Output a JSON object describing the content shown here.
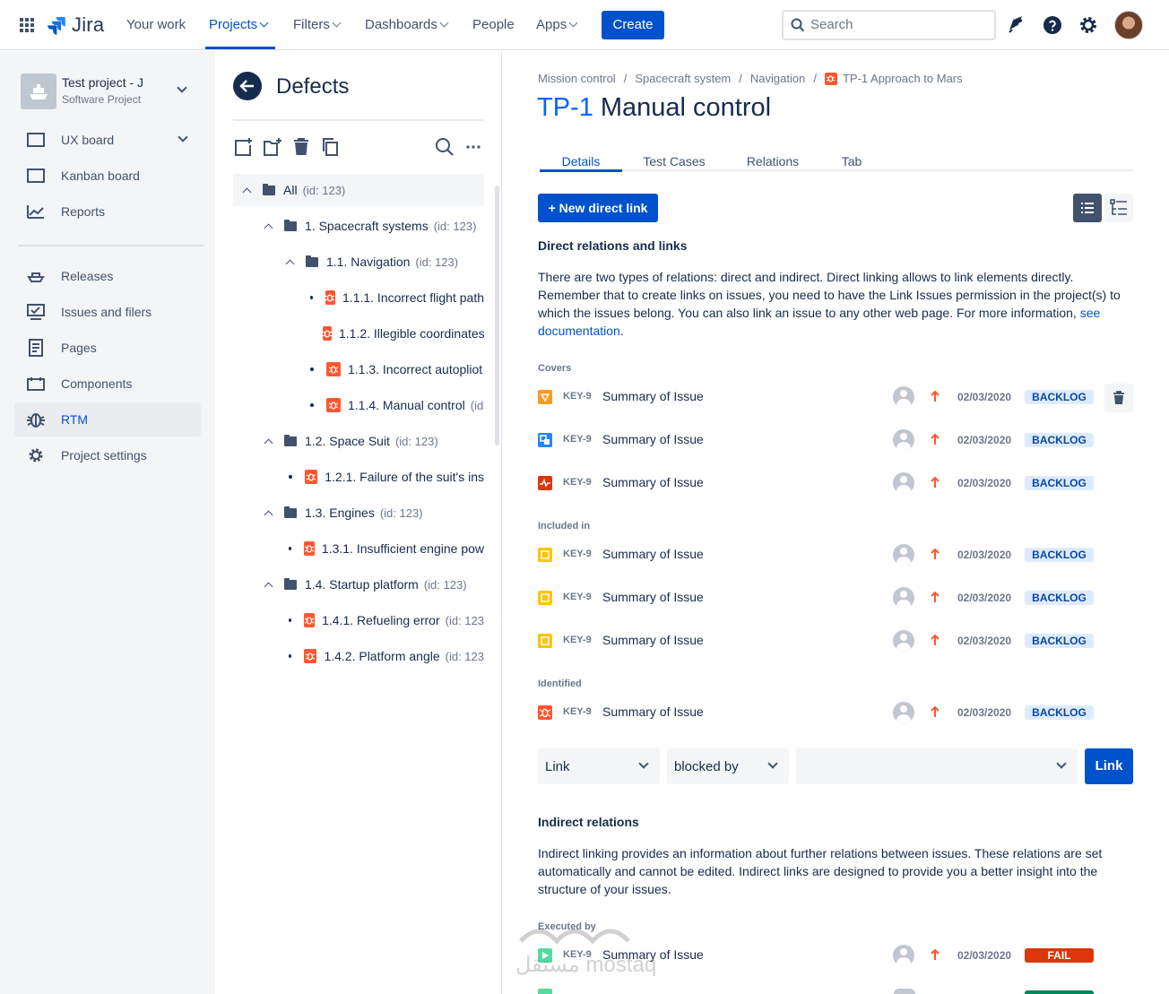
{
  "topnav": {
    "logo": "Jira",
    "items": [
      {
        "label": "Your work",
        "has_chevron": false
      },
      {
        "label": "Projects",
        "has_chevron": true,
        "active": true
      },
      {
        "label": "Filters",
        "has_chevron": true
      },
      {
        "label": "Dashboards",
        "has_chevron": true
      },
      {
        "label": "People",
        "has_chevron": false
      },
      {
        "label": "Apps",
        "has_chevron": true
      }
    ],
    "create_label": "Create",
    "search_placeholder": "Search",
    "icons": [
      "notifications-icon",
      "help-icon",
      "settings-icon",
      "user-avatar"
    ]
  },
  "sidebar": {
    "project_name": "Test project - J",
    "project_type": "Software Project",
    "items": [
      {
        "label": "UX board",
        "icon": "board-icon"
      },
      {
        "label": "Kanban board",
        "icon": "board-icon"
      },
      {
        "label": "Reports",
        "icon": "reports-icon"
      },
      {
        "label": "Releases",
        "icon": "releases-icon"
      },
      {
        "label": "Issues and filers",
        "icon": "issues-icon"
      },
      {
        "label": "Pages",
        "icon": "pages-icon"
      },
      {
        "label": "Components",
        "icon": "components-icon"
      },
      {
        "label": "RTM",
        "icon": "bug-icon",
        "active": true
      },
      {
        "label": "Project settings",
        "icon": "gear-icon"
      }
    ]
  },
  "tree": {
    "title": "Defects",
    "rows": [
      {
        "label": "All",
        "id": "(id: 123)"
      },
      {
        "label": "1. Spacecraft  systems",
        "id": "(id: 123)"
      },
      {
        "label": "1.1. Navigation",
        "id": "(id: 123)"
      },
      {
        "label": "1.1.1. Incorrect flight path",
        "id": ""
      },
      {
        "label": "1.1.2. Illegible coordinates",
        "id": ""
      },
      {
        "label": "1.1.3. Incorrect autopliot",
        "id": ""
      },
      {
        "label": "1.1.4. Manual control",
        "id": "(id"
      },
      {
        "label": "1.2. Space Suit",
        "id": "(id: 123)"
      },
      {
        "label": "1.2.1. Failure of the suit's ins",
        "id": ""
      },
      {
        "label": "1.3. Engines",
        "id": "(id: 123)"
      },
      {
        "label": "1.3.1. Insufficient engine pow",
        "id": ""
      },
      {
        "label": "1.4. Startup platform",
        "id": "(id: 123)"
      },
      {
        "label": "1.4.1. Refueling error",
        "id": "(id: 123"
      },
      {
        "label": "1.4.2. Platform angle",
        "id": "(id: 123"
      }
    ]
  },
  "main": {
    "breadcrumbs": [
      "Mission control",
      "Spacecraft system",
      "Navigation",
      "TP-1 Approach to Mars"
    ],
    "issue_key": "TP-1",
    "issue_title": "Manual control",
    "tabs": [
      "Details",
      "Test Cases",
      "Relations",
      "Tab"
    ],
    "new_link_label": "+ New direct link",
    "direct_heading": "Direct relations and links",
    "direct_text": "There are two types of relations: direct and indirect. Direct linking allows to link elements directly. Remember that to create links on issues, you need to have the Link Issues permission in the project(s) to which the issues belong. You can also link an issue to any other web page. For more information, ",
    "direct_link_text": "see documentation",
    "direct_text_end": ".",
    "groups": [
      {
        "label": "Covers",
        "rows": [
          {
            "type_color": "#FF991F",
            "key": "KEY-9",
            "summary": "Summary of Issue",
            "date": "02/03/2020",
            "status": "BACKLOG"
          },
          {
            "type_color": "#2684FF",
            "key": "KEY-9",
            "summary": "Summary of Issue",
            "date": "02/03/2020",
            "status": "BACKLOG"
          },
          {
            "type_color": "#DE350B",
            "key": "KEY-9",
            "summary": "Summary of Issue",
            "date": "02/03/2020",
            "status": "BACKLOG"
          }
        ]
      },
      {
        "label": "Included in",
        "rows": [
          {
            "type_color": "#FFC400",
            "key": "KEY-9",
            "summary": "Summary of Issue",
            "date": "02/03/2020",
            "status": "BACKLOG"
          },
          {
            "type_color": "#FFC400",
            "key": "KEY-9",
            "summary": "Summary of Issue",
            "date": "02/03/2020",
            "status": "BACKLOG"
          },
          {
            "type_color": "#FFC400",
            "key": "KEY-9",
            "summary": "Summary of Issue",
            "date": "02/03/2020",
            "status": "BACKLOG"
          }
        ]
      },
      {
        "label": "Identified",
        "rows": [
          {
            "type_color": "#FF5630",
            "key": "KEY-9",
            "summary": "Summary of Issue",
            "date": "02/03/2020",
            "status": "BACKLOG"
          }
        ]
      }
    ],
    "link_form": {
      "type_value": "Link",
      "relation_value": "blocked by",
      "issue_value": "",
      "button_label": "Link"
    },
    "indirect_heading": "Indirect relations",
    "indirect_text": "Indirect linking provides an information about further relations  between issues. These relations are set automatically and cannot be edited. Indirect links are designed to provide you a better insight into the structure of your issues.",
    "indirect_groups": [
      {
        "label": "Executed by",
        "rows": [
          {
            "type_color": "#57D9A3",
            "key": "KEY-9",
            "summary": "Summary of Issue",
            "date": "02/03/2020",
            "status": "FAIL"
          }
        ]
      }
    ],
    "watermark": "مستقل mostaql.com"
  }
}
